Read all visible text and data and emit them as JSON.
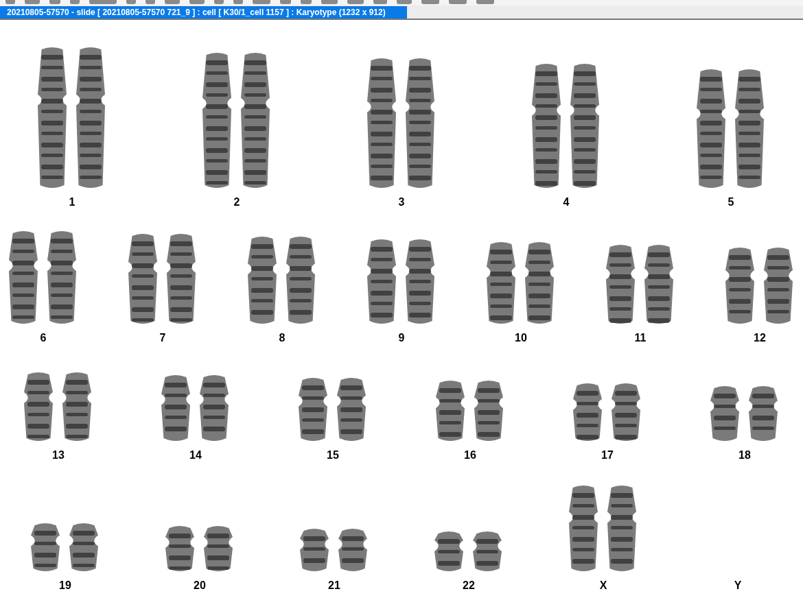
{
  "tab": {
    "title": "20210805-57570 - slide [ 20210805-57570 721_9 ] : cell [ K30/1_cell 1157 ] : Karyotype  (1232 x 912)",
    "selected": true
  },
  "karyotype_rows": [
    {
      "groups": [
        {
          "label": "1",
          "empty": false
        },
        {
          "label": "2",
          "empty": false
        },
        {
          "label": "3",
          "empty": false
        },
        {
          "label": "4",
          "empty": false
        },
        {
          "label": "5",
          "empty": false
        }
      ]
    },
    {
      "groups": [
        {
          "label": "6",
          "empty": false
        },
        {
          "label": "7",
          "empty": false
        },
        {
          "label": "8",
          "empty": false
        },
        {
          "label": "9",
          "empty": false
        },
        {
          "label": "10",
          "empty": false
        },
        {
          "label": "11",
          "empty": false
        },
        {
          "label": "12",
          "empty": false
        }
      ]
    },
    {
      "groups": [
        {
          "label": "13",
          "empty": false
        },
        {
          "label": "14",
          "empty": false
        },
        {
          "label": "15",
          "empty": false
        },
        {
          "label": "16",
          "empty": false
        },
        {
          "label": "17",
          "empty": false
        },
        {
          "label": "18",
          "empty": false
        }
      ]
    },
    {
      "groups": [
        {
          "label": "19",
          "empty": false
        },
        {
          "label": "20",
          "empty": false
        },
        {
          "label": "21",
          "empty": false
        },
        {
          "label": "22",
          "empty": false
        },
        {
          "label": "X",
          "empty": false
        },
        {
          "label": "Y",
          "empty": true
        }
      ]
    }
  ]
}
